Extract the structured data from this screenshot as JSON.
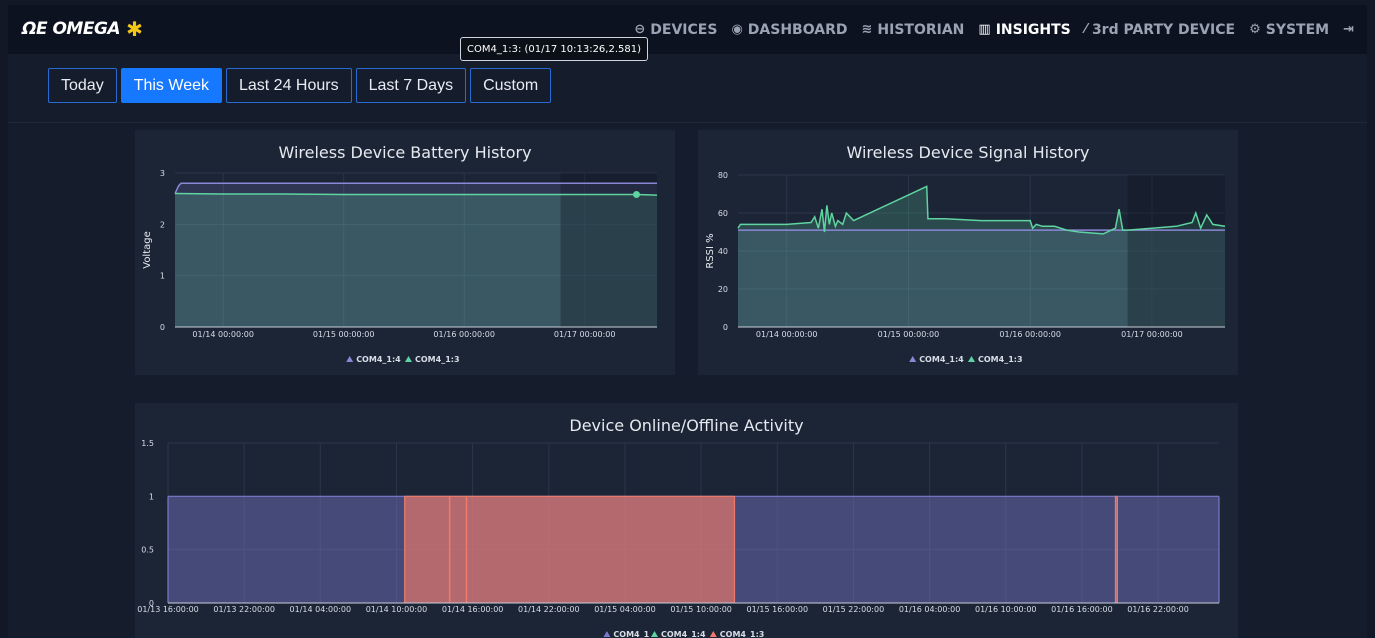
{
  "brand": {
    "logo_text": "ΩE OMEGA",
    "logo_mark": "✱",
    "accent": "#f5c518"
  },
  "nav": [
    {
      "label": "DEVICES",
      "icon": "⊖",
      "icon_name": "devices-icon",
      "active": false
    },
    {
      "label": "DASHBOARD",
      "icon": "◉",
      "icon_name": "dashboard-icon",
      "active": false
    },
    {
      "label": "HISTORIAN",
      "icon": "≋",
      "icon_name": "database-icon",
      "active": false
    },
    {
      "label": "INSIGHTS",
      "icon": "▥",
      "icon_name": "bar-chart-icon",
      "active": true
    },
    {
      "label": "3rd PARTY DEVICE",
      "icon": "⁄",
      "icon_name": "magic-wand-icon",
      "active": false
    },
    {
      "label": "SYSTEM",
      "icon": "⚙",
      "icon_name": "gears-icon",
      "active": false
    },
    {
      "label": "",
      "icon": "⇥",
      "icon_name": "logout-icon",
      "active": false
    }
  ],
  "tabs": [
    {
      "label": "Today",
      "active": false
    },
    {
      "label": "This Week",
      "active": true
    },
    {
      "label": "Last 24 Hours",
      "active": false
    },
    {
      "label": "Last 7 Days",
      "active": false
    },
    {
      "label": "Custom",
      "active": false
    }
  ],
  "tooltip": {
    "text": "COM4_1:3: (01/17 10:13:26,2.581)"
  },
  "chart_data": [
    {
      "type": "area",
      "title": "Wireless Device Battery History",
      "ylabel": "Voltage",
      "xlabel": "",
      "ylim": [
        0,
        3
      ],
      "yticks": [
        0,
        1,
        2,
        3
      ],
      "xticks": [
        "01/14 00:00:00",
        "01/15 00:00:00",
        "01/16 00:00:00",
        "01/17 00:00:00"
      ],
      "xrange_days": [
        13.6,
        17.6
      ],
      "legend": [
        "COM4_1:4",
        "COM4_1:3"
      ],
      "grid": true,
      "legend_position": "bottom",
      "series": [
        {
          "name": "COM4_1:4",
          "color": "#8a87d6",
          "x": [
            13.6,
            13.63,
            13.65,
            14.5,
            15.5,
            16.5,
            17.6
          ],
          "values": [
            2.6,
            2.75,
            2.8,
            2.8,
            2.8,
            2.8,
            2.8
          ]
        },
        {
          "name": "COM4_1:3",
          "color": "#5fd3a0",
          "x": [
            13.6,
            14.0,
            14.5,
            15.0,
            15.5,
            16.0,
            16.5,
            17.0,
            17.43,
            17.6
          ],
          "values": [
            2.6,
            2.59,
            2.59,
            2.58,
            2.58,
            2.58,
            2.58,
            2.58,
            2.581,
            2.57
          ]
        }
      ]
    },
    {
      "type": "line",
      "title": "Wireless Device Signal History",
      "ylabel": "RSSI %",
      "xlabel": "",
      "ylim": [
        0,
        80
      ],
      "yticks": [
        0,
        20,
        40,
        60,
        80
      ],
      "xticks": [
        "01/14 00:00:00",
        "01/15 00:00:00",
        "01/16 00:00:00",
        "01/17 00:00:00"
      ],
      "xrange_days": [
        13.6,
        17.6
      ],
      "legend": [
        "COM4_1:4",
        "COM4_1:3"
      ],
      "grid": true,
      "legend_position": "bottom",
      "series": [
        {
          "name": "COM4_1:4",
          "color": "#8a87d6",
          "x": [
            13.6,
            17.6
          ],
          "values": [
            51,
            51
          ]
        },
        {
          "name": "COM4_1:3",
          "color": "#5fd3a0",
          "x": [
            13.6,
            13.62,
            14.0,
            14.2,
            14.23,
            14.26,
            14.29,
            14.31,
            14.33,
            14.35,
            14.37,
            14.4,
            14.42,
            14.46,
            14.49,
            14.52,
            14.55,
            15.15,
            15.16,
            15.3,
            15.6,
            15.9,
            16.0,
            16.02,
            16.05,
            16.1,
            16.2,
            16.3,
            16.4,
            16.6,
            16.7,
            16.73,
            16.76,
            16.8,
            17.0,
            17.2,
            17.33,
            17.36,
            17.4,
            17.45,
            17.5,
            17.6
          ],
          "values": [
            52,
            54,
            54,
            55,
            58,
            52,
            62,
            50,
            64,
            54,
            60,
            53,
            56,
            54,
            60,
            58,
            56,
            74,
            57,
            57,
            56,
            56,
            56,
            52,
            54,
            53,
            53,
            51,
            50,
            49,
            52,
            62,
            51,
            51,
            52,
            53,
            55,
            60,
            52,
            59,
            54,
            53
          ]
        }
      ]
    },
    {
      "type": "area",
      "title": "Device Online/Offline Activity",
      "ylabel": "",
      "xlabel": "",
      "ylim": [
        0,
        1.5
      ],
      "yticks": [
        0,
        0.5,
        1,
        1.5
      ],
      "xticks": [
        "01/13 16:00:00",
        "01/13 22:00:00",
        "01/14 04:00:00",
        "01/14 10:00:00",
        "01/14 16:00:00",
        "01/14 22:00:00",
        "01/15 04:00:00",
        "01/15 10:00:00",
        "01/15 16:00:00",
        "01/15 22:00:00",
        "01/16 04:00:00",
        "01/16 10:00:00",
        "01/16 16:00:00",
        "01/16 22:00:00"
      ],
      "legend": [
        "COM4_1",
        "COM4_1:4",
        "COM4_1:3"
      ],
      "grid": true,
      "legend_position": "bottom",
      "series": [
        {
          "name": "COM4_1",
          "color": "#7b78c9",
          "state": [
            [
              0,
              1.0,
              1
            ]
          ]
        },
        {
          "name": "COM4_1:4",
          "color": "#5fd3a0",
          "state": []
        },
        {
          "name": "COM4_1:3",
          "color": "#f07a6a",
          "state": [
            [
              0.2252,
              0.539,
              1
            ],
            [
              0.539,
              0.9015,
              0
            ],
            [
              0.9015,
              0.9033,
              1
            ]
          ]
        }
      ]
    }
  ]
}
